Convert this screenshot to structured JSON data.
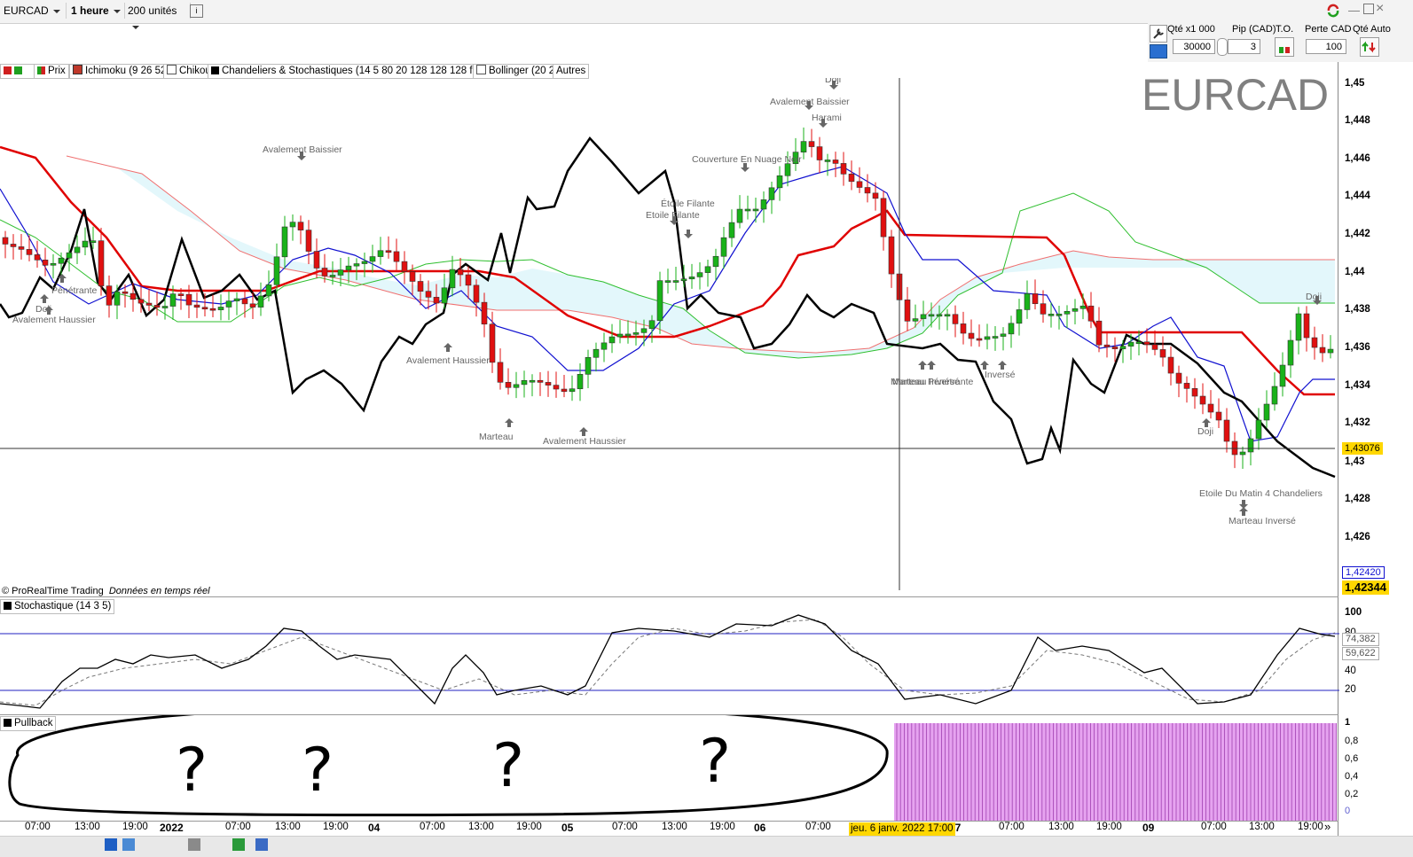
{
  "toolbar": {
    "symbol": "EURCAD",
    "timeframe": "1 heure",
    "units": "200 unités",
    "info_icon": "info-icon"
  },
  "order_panel": {
    "qty_label": "Qté x1 000",
    "qty_value": "30000",
    "pip_label": "Pip (CAD)",
    "pip_value": "3",
    "to_label": "T.O.",
    "loss_label": "Perte CAD",
    "loss_value": "100",
    "auto_label": "Qté Auto"
  },
  "legend": {
    "price": "Prix",
    "ichimoku": "Ichimoku (9 26 52)",
    "chikou": "Chikou",
    "candles": "Chandeliers & Stochastiques (14 5 80 20 128 128 128 f t t)",
    "bollinger": "Bollinger (20 2)",
    "others": "Autres"
  },
  "watermark": "EURCAD",
  "footer": {
    "copyright": "© ProRealTime Trading",
    "realtime": "Données en temps réel"
  },
  "price_axis": {
    "ticks": [
      "1,45",
      "1,448",
      "1,446",
      "1,444",
      "1,442",
      "1,44",
      "1,438",
      "1,436",
      "1,434",
      "1,432",
      "1,43",
      "1,428",
      "1,426"
    ],
    "crosshair_value": "1,43076",
    "blue_value": "1,42420",
    "last_value": "1,42344"
  },
  "stoch": {
    "title": "Stochastique (14 3 5)",
    "ticks": [
      "100",
      "80",
      "60",
      "40",
      "20"
    ],
    "k_value": "74,382",
    "d_value": "59,622"
  },
  "pullback": {
    "title": "Pullback",
    "ticks": [
      "1",
      "0,8",
      "0,6",
      "0,4",
      "0,2",
      "0"
    ],
    "annotation_marks": [
      "?",
      "?",
      "?",
      "?"
    ]
  },
  "time_axis": {
    "labels": [
      "07:00",
      "13:00",
      "19:00",
      "2022",
      "07:00",
      "13:00",
      "19:00",
      "04",
      "07:00",
      "13:00",
      "19:00",
      "05",
      "07:00",
      "13:00",
      "19:00",
      "06",
      "07:00",
      "07",
      "07:00",
      "13:00",
      "19:00",
      "09",
      "07:00",
      "13:00",
      "19:00"
    ],
    "crosshair_label": "jeu. 6 janv. 2022 17:00"
  },
  "patterns": [
    "Avalement Baissier",
    "Avalement Haussier",
    "Doji",
    "Pénétrante",
    "Étoile Filante",
    "Etoile Filante",
    "Couverture En Nuage Noir",
    "Avalement Baissier",
    "Doji",
    "Harami",
    "Marteau",
    "Marteau Inversé",
    "Pénétrante",
    "Avalement Haussier",
    "Etoile Du Matin 4 Chandeliers",
    "Marteau Inversé",
    "Doji",
    "Doji",
    "Marteau",
    "Avalement Haussier",
    "Inversé"
  ],
  "colors": {
    "cloud_fill": "#e3f7fb",
    "tenkan": "#1010d0",
    "kijun": "#e00000",
    "chikou": "#000000",
    "bull": "#19b219",
    "bear": "#e01010",
    "pullback_bar": "#e6a3f0"
  }
}
